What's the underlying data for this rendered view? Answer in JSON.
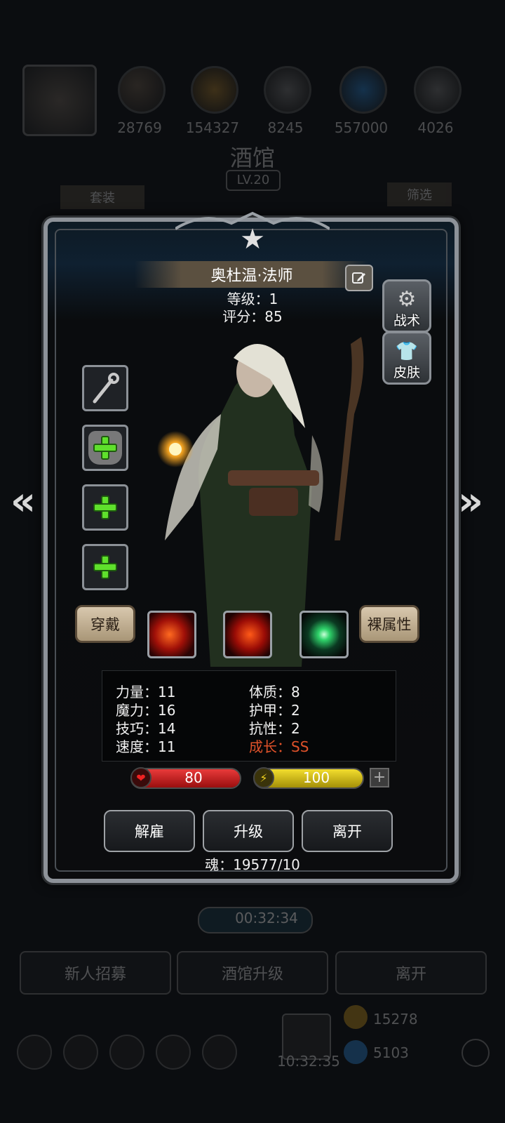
{
  "colors": {
    "hp": "#c41a1a",
    "mp": "#c9b40e",
    "growth": "#e0522a",
    "plus": "#5fe02c"
  },
  "background": {
    "resources": [
      "28769",
      "154327",
      "8245",
      "557000",
      "4026"
    ],
    "title": "酒馆",
    "level": "LV.20",
    "tab_left": "套装",
    "tab_right": "筛选",
    "timer": "00:32:34",
    "buttons": [
      "新人招募",
      "酒馆升级",
      "离开"
    ],
    "clock": "10:32:35",
    "counter_1": "15278",
    "counter_2": "5103"
  },
  "hero": {
    "name": "奥杜温·法师",
    "level_text": "等级：1",
    "score_text": "评分：85",
    "side_buttons": {
      "tactics": "战术",
      "skin": "皮肤"
    },
    "equip_slots": [
      {
        "icon": "staff-icon"
      },
      {
        "icon": "armor-add-icon"
      },
      {
        "icon": "add-icon"
      },
      {
        "icon": "add-icon"
      }
    ],
    "wear_button": "穿戴",
    "bare_attr_button": "裸属性",
    "skills": [
      {
        "icon": "fire-skill-icon"
      },
      {
        "icon": "fire-skill-icon"
      },
      {
        "icon": "green-crystal-skill-icon"
      }
    ],
    "stats": {
      "left": [
        "力量：11",
        "魔力：16",
        "技巧：14",
        "速度：11"
      ],
      "right": [
        "体质：8",
        "护甲：2",
        "抗性：2"
      ],
      "growth": "成长：SS"
    },
    "hp": {
      "value": "80",
      "fill": 1.0
    },
    "mp": {
      "value": "100",
      "fill": 1.0
    },
    "actions": [
      "解雇",
      "升级",
      "离开"
    ],
    "soul": "魂：19577/10"
  }
}
